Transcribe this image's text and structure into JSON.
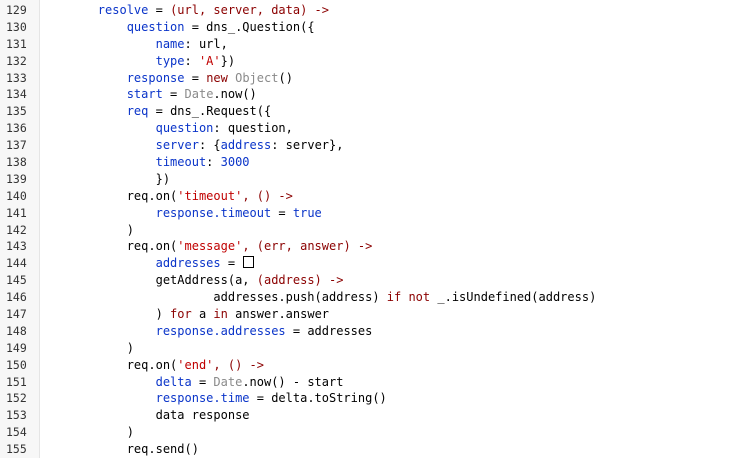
{
  "editor": {
    "line_numbers": [
      "129",
      "130",
      "131",
      "132",
      "133",
      "134",
      "135",
      "136",
      "137",
      "138",
      "139",
      "140",
      "141",
      "142",
      "143",
      "144",
      "145",
      "146",
      "147",
      "148",
      "149",
      "150",
      "151",
      "152",
      "153",
      "154",
      "155"
    ],
    "lines": [
      {
        "indent": "        ",
        "tokens": [
          {
            "t": "resolve",
            "c": "id"
          },
          {
            "t": " = ",
            "c": "text"
          },
          {
            "t": "(url, server, data) ->",
            "c": "kw"
          }
        ]
      },
      {
        "indent": "            ",
        "tokens": [
          {
            "t": "question",
            "c": "id"
          },
          {
            "t": " = dns_.Question({",
            "c": "text"
          }
        ]
      },
      {
        "indent": "                ",
        "tokens": [
          {
            "t": "name",
            "c": "id"
          },
          {
            "t": ": url,",
            "c": "text"
          }
        ]
      },
      {
        "indent": "                ",
        "tokens": [
          {
            "t": "type",
            "c": "id"
          },
          {
            "t": ": ",
            "c": "text"
          },
          {
            "t": "'A'",
            "c": "str"
          },
          {
            "t": "})",
            "c": "text"
          }
        ]
      },
      {
        "indent": "            ",
        "tokens": [
          {
            "t": "response",
            "c": "id"
          },
          {
            "t": " = ",
            "c": "text"
          },
          {
            "t": "new",
            "c": "kw"
          },
          {
            "t": " ",
            "c": "text"
          },
          {
            "t": "Object",
            "c": "cls"
          },
          {
            "t": "()",
            "c": "text"
          }
        ]
      },
      {
        "indent": "            ",
        "tokens": [
          {
            "t": "start",
            "c": "id"
          },
          {
            "t": " = ",
            "c": "text"
          },
          {
            "t": "Date",
            "c": "cls"
          },
          {
            "t": ".now()",
            "c": "text"
          }
        ]
      },
      {
        "indent": "            ",
        "tokens": [
          {
            "t": "req",
            "c": "id"
          },
          {
            "t": " = dns_.Request({",
            "c": "text"
          }
        ]
      },
      {
        "indent": "                ",
        "tokens": [
          {
            "t": "question",
            "c": "id"
          },
          {
            "t": ": question,",
            "c": "text"
          }
        ]
      },
      {
        "indent": "                ",
        "tokens": [
          {
            "t": "server",
            "c": "id"
          },
          {
            "t": ": {",
            "c": "text"
          },
          {
            "t": "address",
            "c": "id"
          },
          {
            "t": ": server},",
            "c": "text"
          }
        ]
      },
      {
        "indent": "                ",
        "tokens": [
          {
            "t": "timeout",
            "c": "id"
          },
          {
            "t": ": ",
            "c": "text"
          },
          {
            "t": "3000",
            "c": "id"
          }
        ]
      },
      {
        "indent": "                ",
        "tokens": [
          {
            "t": "})",
            "c": "text"
          }
        ]
      },
      {
        "indent": "            ",
        "tokens": [
          {
            "t": "req.on(",
            "c": "text"
          },
          {
            "t": "'timeout'",
            "c": "str"
          },
          {
            "t": ", () ->",
            "c": "kw"
          }
        ]
      },
      {
        "indent": "                ",
        "tokens": [
          {
            "t": "response.timeout",
            "c": "id"
          },
          {
            "t": " = ",
            "c": "text"
          },
          {
            "t": "true",
            "c": "id"
          }
        ]
      },
      {
        "indent": "            ",
        "tokens": [
          {
            "t": ")",
            "c": "text"
          }
        ]
      },
      {
        "indent": "            ",
        "tokens": [
          {
            "t": "req.on(",
            "c": "text"
          },
          {
            "t": "'message'",
            "c": "str"
          },
          {
            "t": ", (err, answer) ->",
            "c": "kw"
          }
        ]
      },
      {
        "indent": "                ",
        "tokens": [
          {
            "t": "addresses",
            "c": "id"
          },
          {
            "t": " = ",
            "c": "text"
          },
          {
            "t": "[]",
            "c": "box"
          }
        ]
      },
      {
        "indent": "                ",
        "tokens": [
          {
            "t": "getAddress(a, ",
            "c": "text"
          },
          {
            "t": "(address) ->",
            "c": "kw"
          }
        ]
      },
      {
        "indent": "                        ",
        "tokens": [
          {
            "t": "addresses.push(address) ",
            "c": "text"
          },
          {
            "t": "if not",
            "c": "kw"
          },
          {
            "t": " _.isUndefined(address)",
            "c": "text"
          }
        ]
      },
      {
        "indent": "                ",
        "tokens": [
          {
            "t": ") ",
            "c": "text"
          },
          {
            "t": "for",
            "c": "kw"
          },
          {
            "t": " a ",
            "c": "text"
          },
          {
            "t": "in",
            "c": "kw"
          },
          {
            "t": " answer.answer",
            "c": "text"
          }
        ]
      },
      {
        "indent": "                ",
        "tokens": [
          {
            "t": "response.addresses",
            "c": "id"
          },
          {
            "t": " = addresses",
            "c": "text"
          }
        ]
      },
      {
        "indent": "            ",
        "tokens": [
          {
            "t": ")",
            "c": "text"
          }
        ]
      },
      {
        "indent": "            ",
        "tokens": [
          {
            "t": "req.on(",
            "c": "text"
          },
          {
            "t": "'end'",
            "c": "str"
          },
          {
            "t": ", () ->",
            "c": "kw"
          }
        ]
      },
      {
        "indent": "                ",
        "tokens": [
          {
            "t": "delta",
            "c": "id"
          },
          {
            "t": " = ",
            "c": "text"
          },
          {
            "t": "Date",
            "c": "cls"
          },
          {
            "t": ".now() - start",
            "c": "text"
          }
        ]
      },
      {
        "indent": "                ",
        "tokens": [
          {
            "t": "response.time",
            "c": "id"
          },
          {
            "t": " = delta.toString()",
            "c": "text"
          }
        ]
      },
      {
        "indent": "                ",
        "tokens": [
          {
            "t": "data response",
            "c": "text"
          }
        ]
      },
      {
        "indent": "            ",
        "tokens": [
          {
            "t": ")",
            "c": "text"
          }
        ]
      },
      {
        "indent": "            ",
        "tokens": [
          {
            "t": "req.send()",
            "c": "text"
          }
        ]
      }
    ]
  }
}
